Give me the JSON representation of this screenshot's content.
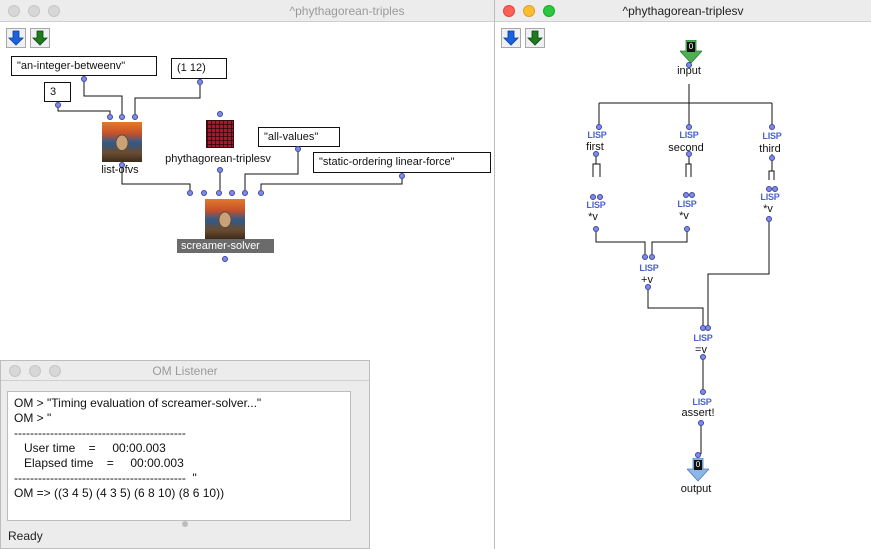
{
  "windows": {
    "patch1": {
      "title": "^phythagorean-triples"
    },
    "patch2": {
      "title": "^phythagorean-triplesv"
    },
    "listener": {
      "title": "OM Listener",
      "status": "Ready"
    }
  },
  "patch1": {
    "boxes": {
      "integer_between": "\"an-integer-betweenv\"",
      "range": "(1 12)",
      "three": "3",
      "all_values": "\"all-values\"",
      "ordering": "\"static-ordering linear-force\""
    },
    "labels": {
      "list_ofvs": "list-ofvs",
      "triples": "phythagorean-triplesv",
      "solver": "screamer-solver"
    }
  },
  "patch2": {
    "input": {
      "label": "input",
      "badge": "0"
    },
    "output": {
      "label": "output",
      "badge": "0"
    },
    "lisp_tag": "LISP",
    "nodes": {
      "first": "first",
      "second": "second",
      "third": "third",
      "mul1": "*v",
      "mul2": "*v",
      "mul3": "*v",
      "plus": "+v",
      "eq": "=v",
      "assert": "assert!"
    }
  },
  "listener": {
    "lines": [
      "OM > \"Timing evaluation of screamer-solver...\"",
      "OM > \"",
      "-------------------------------------------",
      "   User time    =     00:00.003",
      "   Elapsed time    =     00:00.003",
      "-------------------------------------------  \"",
      "OM => ((3 4 5) (4 3 5) (6 8 10) (8 6 10))"
    ]
  },
  "colors": {
    "port_fill": "#7f8be6",
    "lisp_text": "#4a64c8",
    "close_red": "#fe5f57",
    "minimize_yellow": "#febc2e",
    "zoom_green": "#28c840"
  }
}
